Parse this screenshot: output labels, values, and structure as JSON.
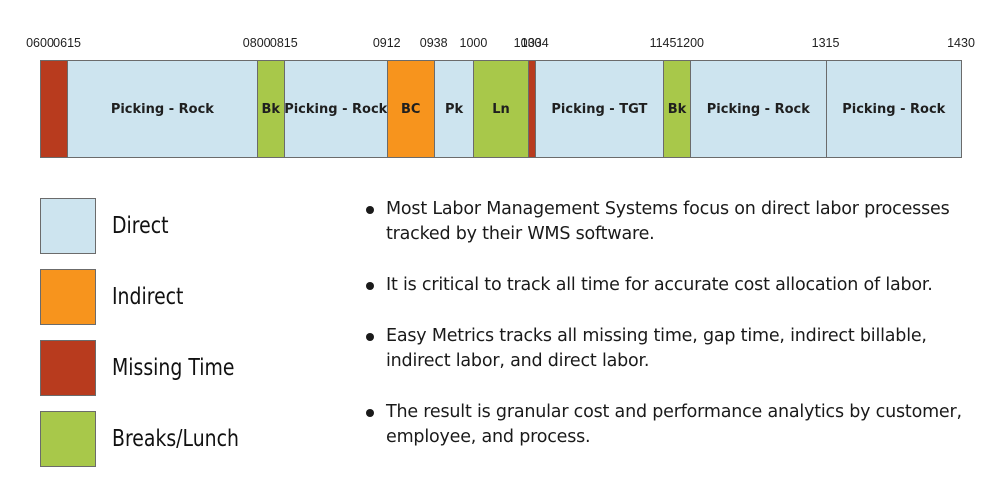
{
  "colors": {
    "direct": "#cde4ef",
    "indirect": "#f7941d",
    "missing_time": "#b83b1e",
    "breaks_lunch": "#a8c84a"
  },
  "timeline": {
    "start": "0600",
    "end": "1430",
    "tick_labels": [
      "0600",
      "0615",
      "0800",
      "0815",
      "0912",
      "0938",
      "1000",
      "1030",
      "1034",
      "1145",
      "1200",
      "1315",
      "1430"
    ],
    "segments": [
      {
        "start": "0600",
        "end": "0615",
        "category": "missing_time",
        "label": ""
      },
      {
        "start": "0615",
        "end": "0800",
        "category": "direct",
        "label": "Picking - Rock"
      },
      {
        "start": "0800",
        "end": "0815",
        "category": "breaks_lunch",
        "label": "Bk"
      },
      {
        "start": "0815",
        "end": "0912",
        "category": "direct",
        "label": "Picking - Rock"
      },
      {
        "start": "0912",
        "end": "0938",
        "category": "indirect",
        "label": "BC"
      },
      {
        "start": "0938",
        "end": "1000",
        "category": "direct",
        "label": "Pk"
      },
      {
        "start": "1000",
        "end": "1030",
        "category": "breaks_lunch",
        "label": "Ln"
      },
      {
        "start": "1030",
        "end": "1034",
        "category": "missing_time",
        "label": ""
      },
      {
        "start": "1034",
        "end": "1145",
        "category": "direct",
        "label": "Picking - TGT"
      },
      {
        "start": "1145",
        "end": "1200",
        "category": "breaks_lunch",
        "label": "Bk"
      },
      {
        "start": "1200",
        "end": "1315",
        "category": "direct",
        "label": "Picking - Rock"
      },
      {
        "start": "1315",
        "end": "1430",
        "category": "direct",
        "label": "Picking - Rock"
      }
    ]
  },
  "legend": [
    {
      "category": "direct",
      "label": "Direct"
    },
    {
      "category": "indirect",
      "label": "Indirect"
    },
    {
      "category": "missing_time",
      "label": "Missing Time"
    },
    {
      "category": "breaks_lunch",
      "label": "Breaks/Lunch"
    }
  ],
  "bullets": [
    "Most Labor Management Systems focus on direct labor processes tracked by their WMS software.",
    "It is critical to track all time for accurate cost allocation of labor.",
    "Easy Metrics tracks all missing time, gap time, indirect billable, indirect labor, and direct labor.",
    "The result is granular cost and performance analytics by customer, employee, and process."
  ]
}
